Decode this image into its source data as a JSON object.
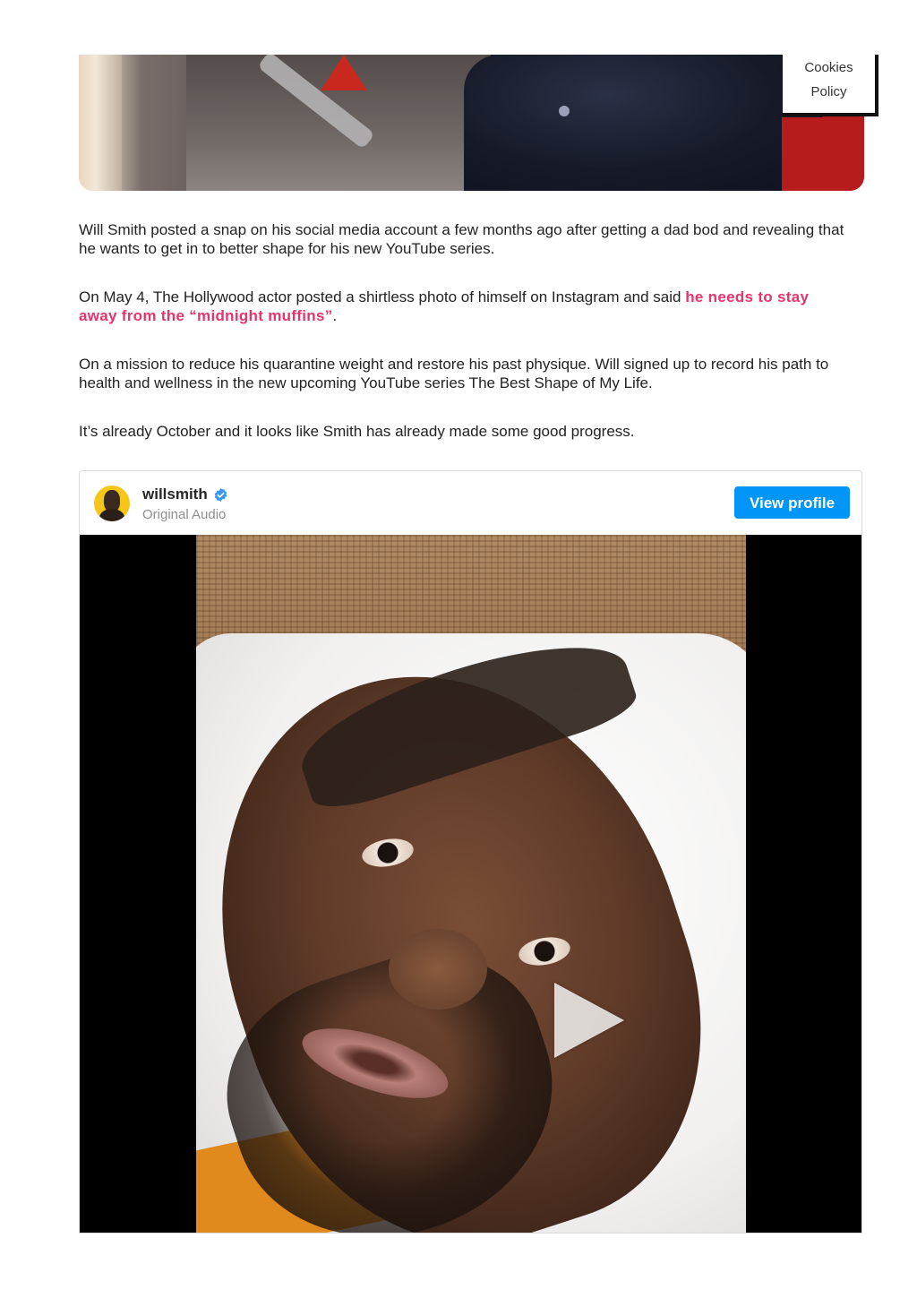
{
  "cookies_tab": {
    "line1": "Cookies",
    "line2": "Policy"
  },
  "article": {
    "paragraphs": [
      {
        "text": "Will Smith posted a snap on his social media account a few months ago after getting a dad bod and revealing that he wants to get in to better shape for his new YouTube series."
      },
      {
        "before": "On May 4, The Hollywood actor posted a shirtless photo of himself on Instagram and said ",
        "link": "he needs to stay away from the “midnight muffins”",
        "after": "."
      },
      {
        "text": "On a mission to reduce his quarantine weight and restore his past physique. Will signed up to record his path to health and wellness in the new upcoming YouTube series The Best Shape of My Life."
      },
      {
        "text": "It’s already October and it looks like Smith has already made some good progress."
      }
    ],
    "link_color": "#e8336d"
  },
  "instagram_embed": {
    "username": "willsmith",
    "verified": true,
    "subtitle": "Original Audio",
    "view_profile_label": "View profile",
    "button_color": "#0095f6",
    "verified_color": "#3897f0"
  }
}
